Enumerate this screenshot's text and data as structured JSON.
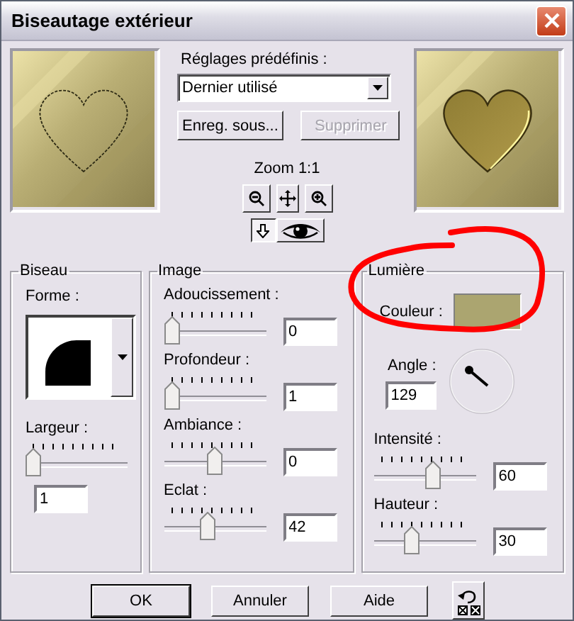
{
  "window": {
    "title": "Biseautage extérieur"
  },
  "presets": {
    "label": "Réglages prédéfinis :",
    "value": "Dernier utilisé",
    "buttons": [
      {
        "label": "Enreg. sous...",
        "disabled": false
      },
      {
        "label": "Supprimer",
        "disabled": true
      }
    ]
  },
  "zoom": {
    "label": "Zoom 1:1"
  },
  "toggles": [
    {
      "kind": "arrow",
      "selected": true
    },
    {
      "kind": "eye",
      "selected": false
    }
  ],
  "groups": [
    {
      "title": "Biseau",
      "items": [
        {
          "kind": "shape",
          "label": "Forme :"
        },
        {
          "kind": "slider-stacked",
          "label": "Largeur :",
          "level": 0,
          "value": "1"
        }
      ]
    },
    {
      "title": "Image",
      "items": [
        {
          "kind": "slider",
          "label": "Adoucissement :",
          "level": 0,
          "value": "0"
        },
        {
          "kind": "slider",
          "label": "Profondeur :",
          "level": 0,
          "value": "1"
        },
        {
          "kind": "slider",
          "label": "Ambiance :",
          "level": 0.5,
          "value": "0"
        },
        {
          "kind": "slider",
          "label": "Eclat :",
          "level": 0.42,
          "value": "42"
        }
      ]
    },
    {
      "title": "Lumière",
      "items": [
        {
          "kind": "color",
          "label": "Couleur :",
          "color": "#aba570"
        },
        {
          "kind": "angle",
          "label": "Angle :",
          "value": "129"
        },
        {
          "kind": "slider",
          "label": "Intensité :",
          "level": 0.6,
          "value": "60"
        },
        {
          "kind": "slider",
          "label": "Hauteur :",
          "level": 0.35,
          "value": "30"
        }
      ]
    }
  ],
  "buttons": [
    "OK",
    "Annuler",
    "Aide"
  ]
}
